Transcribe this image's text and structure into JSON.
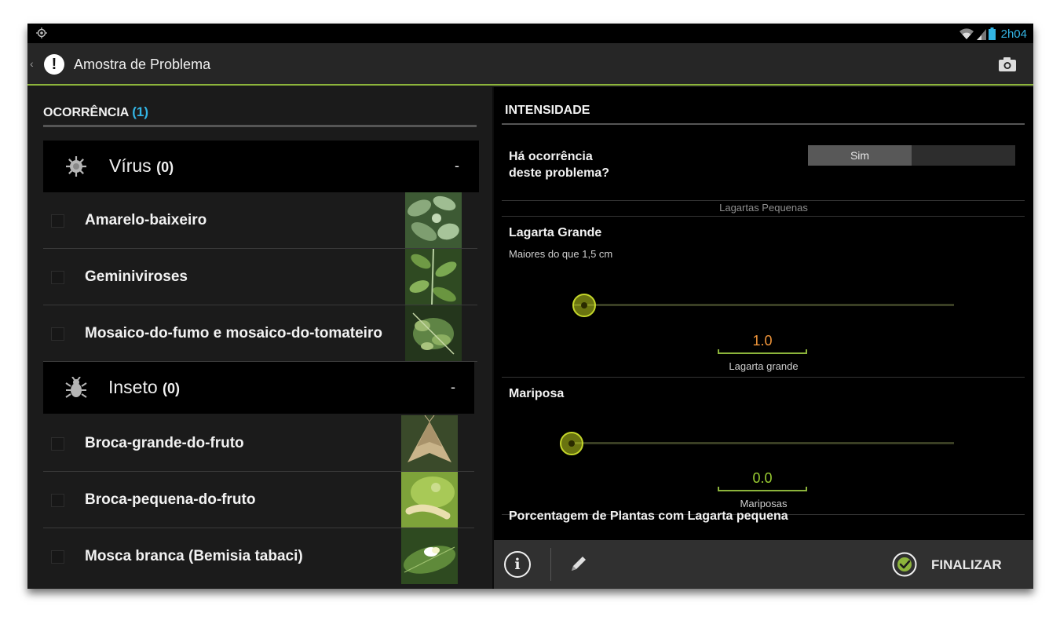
{
  "status_bar": {
    "time": "2h04",
    "time_color": "#33b5e5"
  },
  "action_bar": {
    "back_glyph": "‹",
    "app_icon_glyph": "!",
    "title": "Amostra de Problema",
    "camera_icon": "camera-icon",
    "accent_color": "#8cb43b"
  },
  "left": {
    "header_label": "OCORRÊNCIA",
    "header_count": "(1)",
    "groups": [
      {
        "title": "Vírus",
        "count": "(0)",
        "toggle": "-",
        "icon": "virus-icon",
        "items": [
          {
            "label": "Amarelo-baixeiro",
            "thumb": "leaf-photo"
          },
          {
            "label": "Geminiviroses",
            "thumb": "leaf-photo"
          },
          {
            "label": "Mosaico-do-fumo e mosaico-do-tomateiro",
            "thumb": "leaf-photo"
          }
        ]
      },
      {
        "title": "Inseto",
        "count": "(0)",
        "toggle": "-",
        "icon": "insect-icon",
        "items": [
          {
            "label": "Broca-grande-do-fruto",
            "thumb": "moth-photo"
          },
          {
            "label": "Broca-pequena-do-fruto",
            "thumb": "larva-photo"
          },
          {
            "label": "Mosca branca (Bemisia tabaci)",
            "thumb": "whitefly-photo"
          }
        ]
      }
    ]
  },
  "right": {
    "header": "INTENSIDADE",
    "occurrence_question_line1": "Há ocorrência",
    "occurrence_question_line2": "deste problema?",
    "toggle_on_label": "Sim",
    "toggle_value": true,
    "partial_label": "Lagartas Pequenas",
    "sliders": [
      {
        "title": "Lagarta Grande",
        "subtitle": "Maiores do que 1,5 cm",
        "value": "1.0",
        "value_color": "#f0953a",
        "value_label": "Lagarta grande"
      },
      {
        "title": "Mariposa",
        "subtitle": "",
        "value": "0.0",
        "value_color": "#9acd32",
        "value_label": "Mariposas"
      }
    ],
    "percentage_title": "Porcentagem de Plantas com Lagarta pequena"
  },
  "bottom_bar": {
    "info_glyph": "i",
    "edit_icon": "pencil-icon",
    "finalize_label": "FINALIZAR",
    "finalize_icon": "check-circle-icon"
  }
}
